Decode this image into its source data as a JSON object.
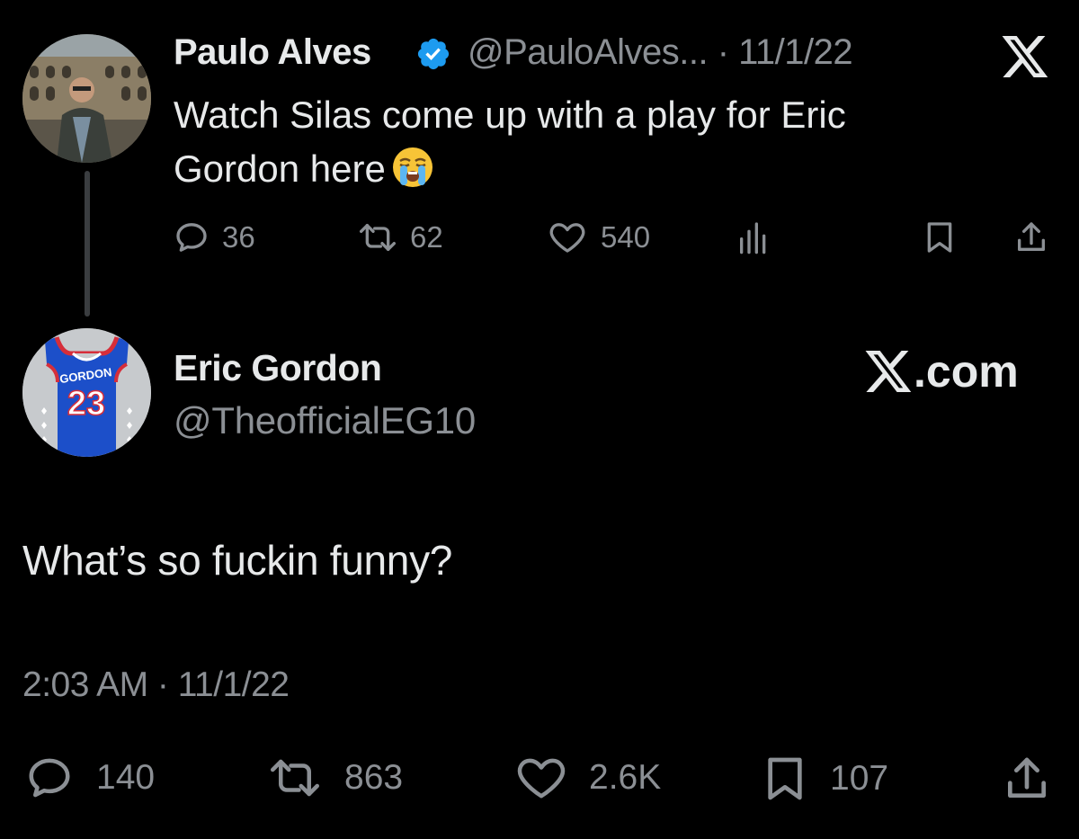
{
  "parent_tweet": {
    "author_name": "Paulo Alves",
    "handle": "@PauloAlves...",
    "separator": "·",
    "date": "11/1/22",
    "text_line1": "Watch Silas come up with a play for Eric",
    "text_line2": "Gordon here",
    "emoji": "loudly-crying-face",
    "actions": {
      "replies": "36",
      "reposts": "62",
      "likes": "540"
    }
  },
  "main_tweet": {
    "author_name": "Eric Gordon",
    "handle": "@TheofficialEG10",
    "avatar_jersey_name": "GORDON",
    "avatar_jersey_number": "23",
    "text": "What’s so fuckin funny?",
    "timestamp": "2:03 AM · 11/1/22",
    "actions": {
      "replies": "140",
      "reposts": "863",
      "likes": "2.6K",
      "bookmarks": "107"
    }
  },
  "branding": {
    "watermark": ".com"
  },
  "colors": {
    "background": "#000000",
    "primary_text": "#e7e9ea",
    "secondary_text": "#8b8f94",
    "verified_badge": "#1d9bf0",
    "thread_line": "#3a3d40"
  }
}
